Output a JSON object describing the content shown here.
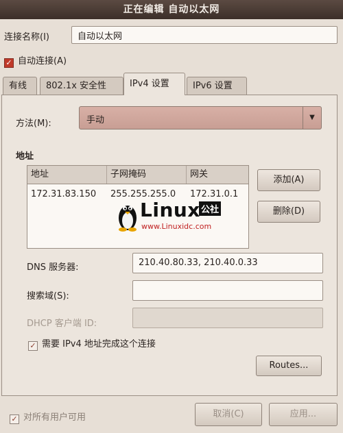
{
  "window": {
    "title": "正在编辑 自动以太网"
  },
  "connection": {
    "name_label": "连接名称(I)",
    "name_value": "自动以太网",
    "auto_connect_label": "自动连接(A)"
  },
  "tabs": [
    {
      "label": "有线"
    },
    {
      "label": "802.1x 安全性"
    },
    {
      "label": "IPv4 设置",
      "active": true
    },
    {
      "label": "IPv6 设置"
    }
  ],
  "ipv4": {
    "method_label": "方法(M):",
    "method_value": "手动",
    "address_heading": "地址",
    "columns": [
      "地址",
      "子网掩码",
      "网关"
    ],
    "rows": [
      {
        "address": "172.31.83.150",
        "netmask": "255.255.255.0",
        "gateway": "172.31.0.1"
      }
    ],
    "add_button": "添加(A)",
    "delete_button": "删除(D)",
    "dns_label": "DNS 服务器:",
    "dns_value": "210.40.80.33, 210.40.0.33",
    "search_label": "搜索域(S):",
    "search_value": "",
    "dhcp_label": "DHCP 客户端 ID:",
    "dhcp_value": "",
    "require_label": "需要 IPv4 地址完成这个连接",
    "routes_button": "Routes..."
  },
  "footer": {
    "all_users_label": "对所有用户可用",
    "cancel_button": "取消(C)",
    "apply_button": "应用..."
  },
  "watermark": {
    "title": "Linux",
    "badge": "公社",
    "url": "www.Linuxidc.com"
  },
  "icons": {
    "combo_arrow": "triangle-down-icon",
    "check": "check-icon",
    "logo": "penguin-icon"
  }
}
